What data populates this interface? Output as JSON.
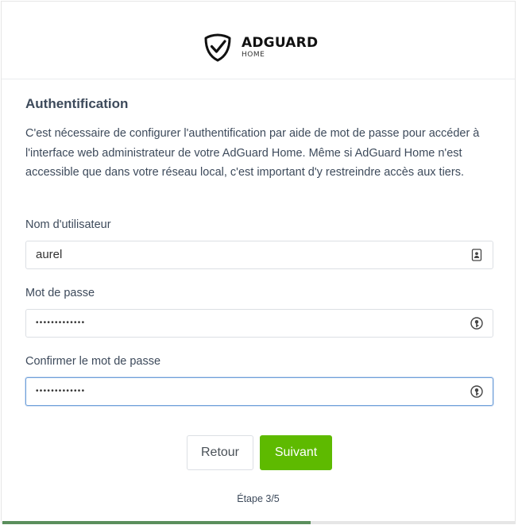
{
  "brand": {
    "name": "ADGUARD",
    "subtitle": "HOME"
  },
  "section": {
    "title": "Authentification",
    "description": "C'est nécessaire de configurer l'authentification par aide de mot de passe pour accéder à l'interface web administrateur de votre AdGuard Home. Même si AdGuard Home n'est accessible que dans votre réseau local, c'est important d'y restreindre accès aux tiers."
  },
  "fields": {
    "username": {
      "label": "Nom d'utilisateur",
      "value": "aurel",
      "icon": "contact-card-icon"
    },
    "password": {
      "label": "Mot de passe",
      "value": "•••••••••••••",
      "icon": "password-key-icon"
    },
    "confirm_password": {
      "label": "Confirmer le mot de passe",
      "value": "•••••••••••••",
      "icon": "password-key-icon",
      "focused": true
    }
  },
  "buttons": {
    "back_label": "Retour",
    "next_label": "Suivant"
  },
  "step": {
    "label": "Étape 3/5",
    "current": 3,
    "total": 5,
    "progress_fraction": 0.6
  },
  "colors": {
    "primary_button": "#5eba00",
    "progress_fill": "#5a8f5c",
    "focus_border": "#6fa0d9",
    "text": "#3d4a5b"
  }
}
